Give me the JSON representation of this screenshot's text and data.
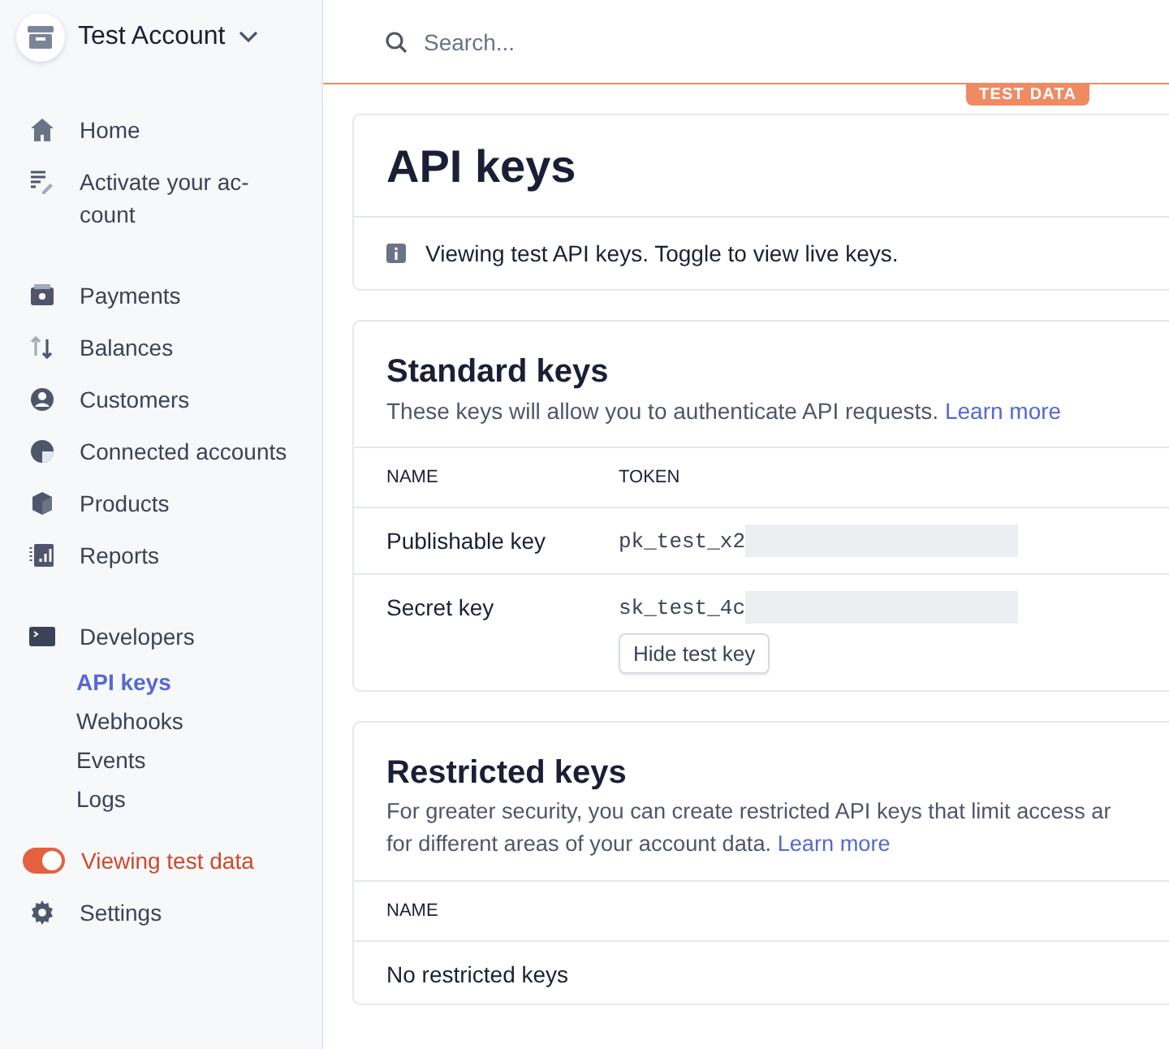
{
  "account": {
    "name": "Test Account"
  },
  "nav": [
    {
      "kind": "item",
      "label": "Home",
      "selected": false
    },
    {
      "kind": "item",
      "label": "Activate your ac-\ncount",
      "selected": false
    },
    {
      "kind": "gap"
    },
    {
      "kind": "item",
      "label": "Payments",
      "selected": false
    },
    {
      "kind": "item",
      "label": "Balances",
      "selected": false
    },
    {
      "kind": "item",
      "label": "Customers",
      "selected": false
    },
    {
      "kind": "item",
      "label": "Connected accounts",
      "selected": false
    },
    {
      "kind": "item",
      "label": "Products",
      "selected": false
    },
    {
      "kind": "item",
      "label": "Reports",
      "selected": false
    },
    {
      "kind": "gap"
    },
    {
      "kind": "item",
      "label": "Developers",
      "selected": false,
      "children": [
        {
          "label": "API keys",
          "selected": true
        },
        {
          "label": "Webhooks",
          "selected": false
        },
        {
          "label": "Events",
          "selected": false
        },
        {
          "label": "Logs",
          "selected": false
        }
      ]
    },
    {
      "kind": "toggle",
      "label": "Viewing test data",
      "on": true
    },
    {
      "kind": "item",
      "label": "Settings",
      "selected": false
    }
  ],
  "search": {
    "placeholder": "Search..."
  },
  "badge": "TEST DATA",
  "page": {
    "title": "API keys",
    "notice": "Viewing test API keys. Toggle to view live keys."
  },
  "standard": {
    "title": "Standard keys",
    "description": "These keys will allow you to authenticate API requests.",
    "link": "Learn more",
    "columns": [
      "NAME",
      "TOKEN"
    ],
    "rows": [
      {
        "name": "Publishable key",
        "token": "pk_test_x2"
      },
      {
        "name": "Secret key",
        "token": "sk_test_4c",
        "button": "Hide test key"
      }
    ]
  },
  "restricted": {
    "title": "Restricted keys",
    "description": "For greater security, you can create restricted API keys that limit access ar\nfor different areas of your account data.",
    "link": "Learn more",
    "columns": [
      "NAME"
    ],
    "empty": "No restricted keys"
  }
}
